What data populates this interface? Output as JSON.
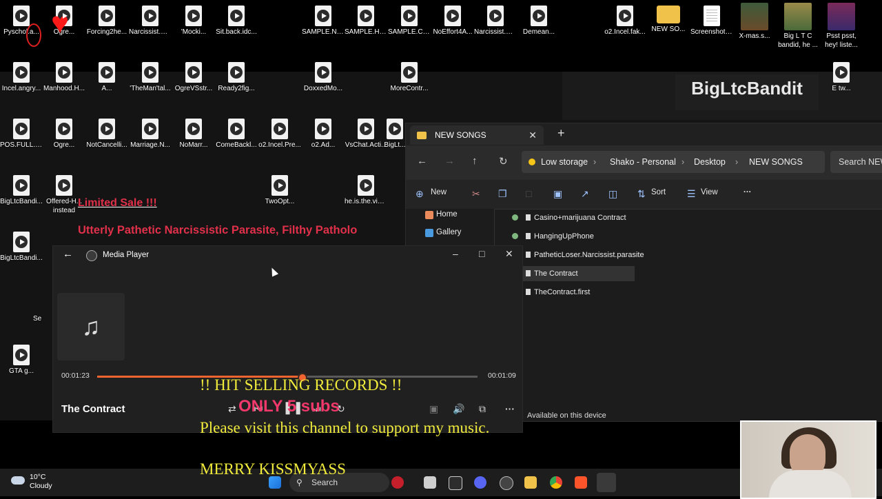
{
  "desktop": {
    "icons": [
      {
        "label": "Pyschol.a..."
      },
      {
        "label": "Ogre..."
      },
      {
        "label": "Forcing2he..."
      },
      {
        "label": "Narcissist.G..."
      },
      {
        "label": "'Mocki..."
      },
      {
        "label": "Sit.back.idc..."
      },
      {
        "label": "SAMPLE.Na..."
      },
      {
        "label": "SAMPLE.Hid..."
      },
      {
        "label": "SAMPLE.Ca..."
      },
      {
        "label": "NoEffort4A..."
      },
      {
        "label": "Narcissist.Fi..."
      },
      {
        "label": "Demean..."
      },
      {
        "label": "o2.Incel.fak..."
      },
      {
        "label": "NEW SO..."
      },
      {
        "label": "Screenshot_..."
      },
      {
        "label": "X-mas.s..."
      },
      {
        "label": "Big L T C bandid, he ..."
      },
      {
        "label": "Psst psst, hey! liste..."
      },
      {
        "label": "Incel.angry..."
      },
      {
        "label": "Manhood.H..."
      },
      {
        "label": "A..."
      },
      {
        "label": "'TheMan'tal..."
      },
      {
        "label": "OgreVSstr..."
      },
      {
        "label": "Ready2fig..."
      },
      {
        "label": "DoxxedMo..."
      },
      {
        "label": "MoreContr..."
      },
      {
        "label": "E tw..."
      },
      {
        "label": "POS.FULL.N..."
      },
      {
        "label": "Ogre..."
      },
      {
        "label": "NotCancelli..."
      },
      {
        "label": "Marriage.N..."
      },
      {
        "label": "NoMarr..."
      },
      {
        "label": "ComeBackl..."
      },
      {
        "label": "o2.Incel.Pre..."
      },
      {
        "label": "o2.Ad..."
      },
      {
        "label": "VsChat.Acti..."
      },
      {
        "label": "BigLt..."
      },
      {
        "label": "BigLtcBandi..."
      },
      {
        "label": "Offered-H... instead"
      },
      {
        "label": "TwoOpt..."
      },
      {
        "label": "he.is.the.vict..."
      },
      {
        "label": "BigLtcBandi..."
      },
      {
        "label": "Se"
      },
      {
        "label": "GTA g..."
      }
    ],
    "banner": "BigLtcBandit",
    "sale_text": "Limited Sale !!!",
    "red_line": "Utterly Pathetic Narcissistic Parasite, Filthy Patholo"
  },
  "explorer": {
    "tab_title": "NEW SONGS",
    "breadcrumbs": [
      "Low storage",
      "Shako - Personal",
      "Desktop",
      "NEW SONGS"
    ],
    "search_placeholder": "Search NEW",
    "cmd": {
      "new": "New",
      "sort": "Sort",
      "view": "View",
      "more": "···"
    },
    "sidebar": [
      {
        "label": "Home"
      },
      {
        "label": "Gallery"
      }
    ],
    "files": [
      "Casino+marijuana Contract",
      "HangingUpPhone",
      "PatheticLoser.Narcissist.parasite",
      "The Contract",
      "TheContract.first"
    ],
    "status": "Available on this device"
  },
  "media_player": {
    "title": "Media Player",
    "elapsed": "00:01:23",
    "remaining": "00:01:09",
    "progress_fraction": 0.54,
    "song_title": "The Contract"
  },
  "overlay": {
    "hit": "!! HIT SELLING RECORDS !!",
    "subs": "ONLY 5 subs",
    "visit": "Please visit this channel to support my music.",
    "merry": "MERRY KISSMYASS"
  },
  "taskbar": {
    "temp": "10°C",
    "condition": "Cloudy",
    "search": "Search"
  },
  "colors": {
    "accent": "#f0652f",
    "overlay_yellow": "#f1eb3c",
    "overlay_red": "#e0304a"
  }
}
